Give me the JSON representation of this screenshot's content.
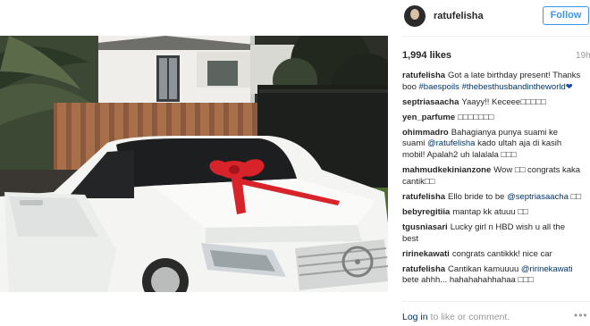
{
  "post": {
    "username": "ratufelisha",
    "follow_label": "Follow",
    "likes": "1,994 likes",
    "time": "19h"
  },
  "caption": {
    "author": "ratufelisha",
    "text": "Got a late birthday present! Thanks boo",
    "tag1": "#baespoils",
    "tag2": "#thebesthusbandintheworld",
    "heart": "❤"
  },
  "comments": [
    {
      "author": "septriasaacha",
      "text": "Yaayy!! Keceee□□□□□"
    },
    {
      "author": "yen_parfume",
      "text": "□□□□□□□"
    },
    {
      "author": "ohimmadro",
      "text_before": "Bahagianya punya suami ke suami",
      "mention": "@ratufelisha",
      "text_after": "kado ultah aja di kasih mobil! Apalah2 uh lalalala □□□"
    },
    {
      "author": "mahmudkekinianzone",
      "text": "Wow □□ congrats kaka cantik□□"
    },
    {
      "author": "ratufelisha",
      "text": "Ello bride to be",
      "mention": "@septriasaacha",
      "text_after": "□□"
    },
    {
      "author": "bebyregitiia",
      "text": "mantap kk atuuu □□"
    },
    {
      "author": "tgusniasari",
      "text": "Lucky girl n HBD wish u all the best"
    },
    {
      "author": "ririnekawati",
      "text": "congrats cantikkk! nice car"
    },
    {
      "author": "ratufelisha",
      "text": "Cantikan kamuuuu",
      "mention": "@ririnekawati",
      "text_after": "bete ahhh... hahahahahhahaa □□□"
    }
  ],
  "footer": {
    "login_link": "Log in",
    "login_text": "to like or comment.",
    "more": "•••"
  },
  "colors": {
    "follow_blue": "#3897f0",
    "link_blue": "#003569",
    "muted_gray": "#999999"
  }
}
